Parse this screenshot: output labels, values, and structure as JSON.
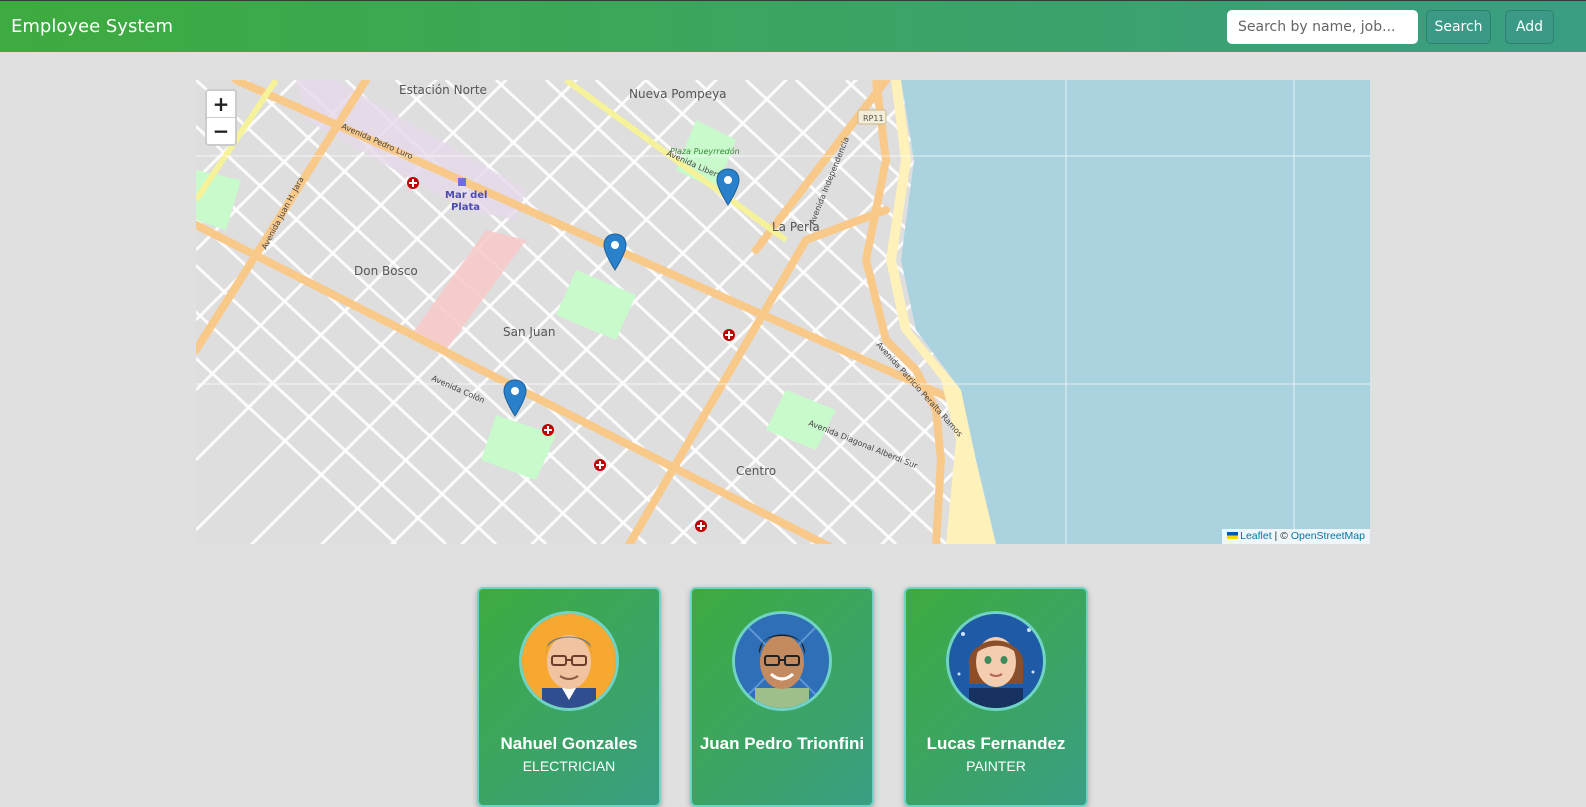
{
  "navbar": {
    "brand": "Employee System",
    "search_placeholder": "Search by name, job...",
    "search_label": "Search",
    "add_label": "Add"
  },
  "map": {
    "zoom_in": "+",
    "zoom_out": "−",
    "attribution": {
      "leaflet": "Leaflet",
      "separator": " | © ",
      "osm": "OpenStreetMap"
    },
    "place_labels": {
      "estacion_norte": "Estación Norte",
      "nueva_pompeya": "Nueva Pompeya",
      "la_perla": "La Perla",
      "don_bosco": "Don Bosco",
      "san_juan": "San Juan",
      "centro": "Centro",
      "mar_del": "Mar del",
      "plata": "Plata",
      "plaza": "Plaza Pueyrredón",
      "rp11": "RP11",
      "av_luro": "Avenida Pedro Luro",
      "av_colon": "Avenida Colón",
      "av_libertad": "Avenida Libertad",
      "av_independencia": "Avenida Independencia",
      "av_peralta": "Avenida Patricio Peralta Ramos",
      "av_alberdi": "Avenida Diagonal Alberdi Sur",
      "av_jara": "Avenida Juan H. Jara"
    },
    "colors": {
      "sea": "#aad3df",
      "land": "#dedede",
      "avenue": "#fcd6a4",
      "park": "#c8facc",
      "beach": "#fff1ba",
      "marker": "#2a81cb"
    }
  },
  "employees": [
    {
      "name": "Nahuel Gonzales",
      "job": "ELECTRICIAN",
      "avatar_bg": "#f7a830"
    },
    {
      "name": "Juan Pedro Trionfini",
      "job": "",
      "avatar_bg": "#2f6fb8"
    },
    {
      "name": "Lucas Fernandez",
      "job": "PAINTER",
      "avatar_bg": "#1f5aa6"
    }
  ]
}
